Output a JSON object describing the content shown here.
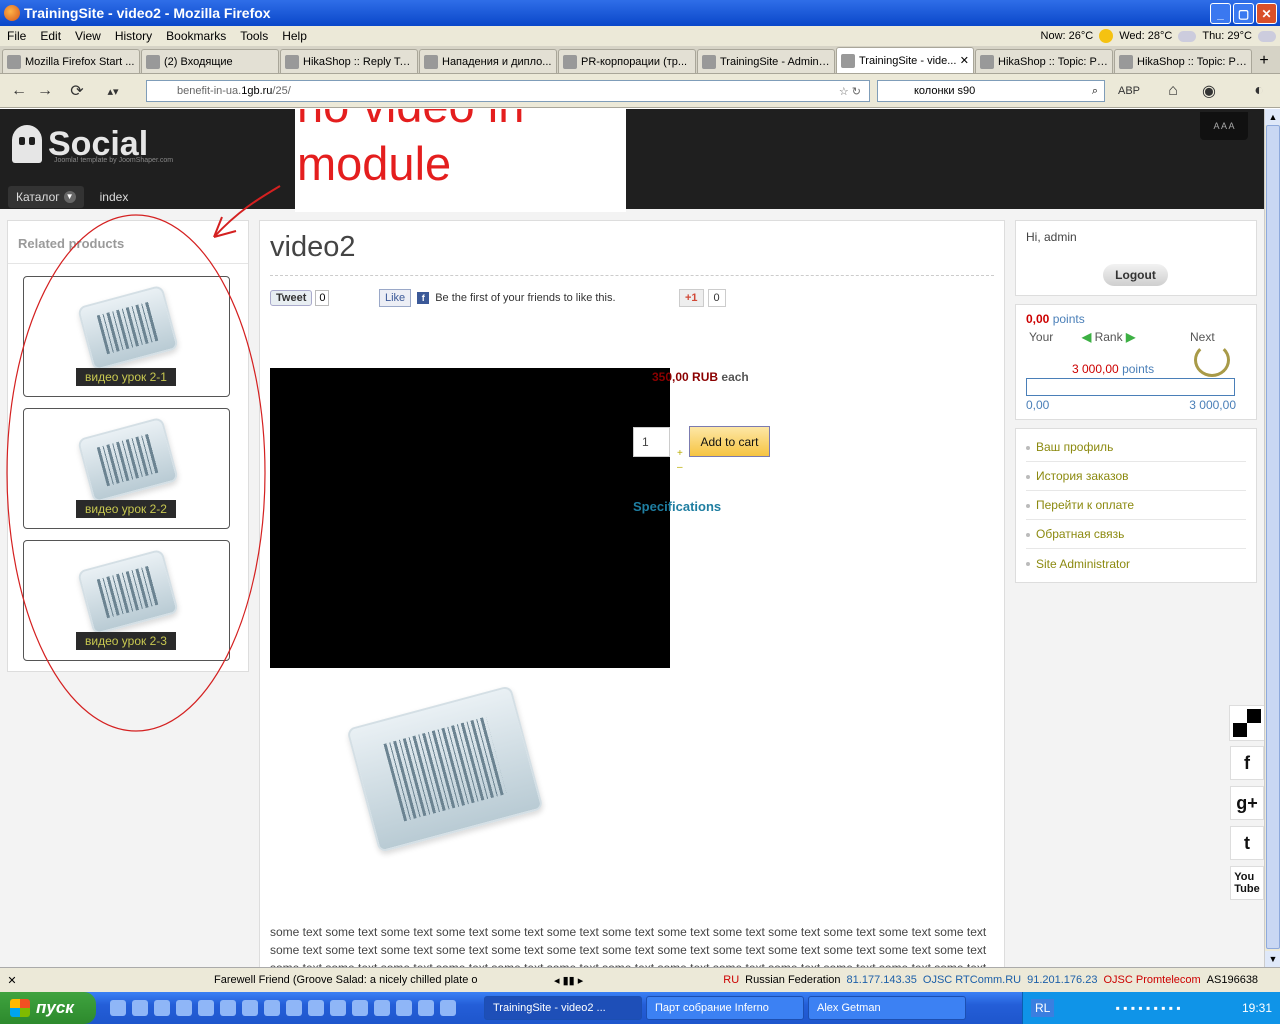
{
  "window": {
    "title": "TrainingSite - video2 - Mozilla Firefox"
  },
  "menubar": {
    "items": [
      "File",
      "Edit",
      "View",
      "History",
      "Bookmarks",
      "Tools",
      "Help"
    ]
  },
  "weather": {
    "now": "Now: 26°C",
    "wed": "Wed: 28°C",
    "thu": "Thu: 29°C"
  },
  "tabs": [
    {
      "label": "Mozilla Firefox Start ...",
      "active": false
    },
    {
      "label": "(2) Входящие",
      "active": false
    },
    {
      "label": "HikaShop :: Reply To...",
      "active": false
    },
    {
      "label": "Нападения и дипло...",
      "active": false
    },
    {
      "label": "PR-корпорации (тр...",
      "active": false
    },
    {
      "label": "TrainingSite - Adminis...",
      "active": false
    },
    {
      "label": "TrainingSite - vide...",
      "active": true
    },
    {
      "label": "HikaShop :: Topic: Pr...",
      "active": false
    },
    {
      "label": "HikaShop :: Topic: Pr...",
      "active": false
    }
  ],
  "nav": {
    "url_pre": "benefit-in-ua.",
    "url_host": "1gb.ru",
    "url_post": "/25/",
    "search": "колонки s90"
  },
  "site": {
    "logo": "Social",
    "logo_sub": "Joomla! template by JoomShaper.com",
    "fontsize": "A A A",
    "nav": [
      "Каталог",
      "index"
    ]
  },
  "annotation": {
    "text": "no video in module",
    "color": "#e41e1e"
  },
  "related": {
    "title": "Related products",
    "items": [
      "видео урок 2-1",
      "видео урок 2-2",
      "видео урок 2-3"
    ]
  },
  "product": {
    "title": "video2",
    "tweet": "Tweet",
    "tweet_count": "0",
    "like": "Like",
    "like_text": "Be the first of your friends to like this.",
    "gplus": "+1",
    "gplus_count": "0",
    "price": "350,00 RUB",
    "price_unit": "each",
    "qty": "1",
    "plus": "+",
    "minus": "–",
    "add_to_cart": "Add to cart",
    "specs": "Specifications",
    "body": "some text some text some text some text some text some text some text some text some text some text some text some text some text some text some text some text some text some text some text some text some text some text some text some text some text some text some text some text some text some text some text some text some text some text some text some text some text some text some text some text"
  },
  "user": {
    "hi": "Hi, admin",
    "logout": "Logout"
  },
  "points": {
    "current_val": "0,00",
    "current_unit": "points",
    "your": "Your",
    "rank": "Rank",
    "next": "Next",
    "next_val": "3 000,00",
    "next_unit": "points",
    "progress": 0,
    "min": "0,00",
    "max": "3 000,00"
  },
  "usermenu": [
    "Ваш профиль",
    "История заказов",
    "Перейти к оплате",
    "Обратная связь",
    "Site Administrator"
  ],
  "social_icons": [
    "delicious-icon",
    "facebook-icon",
    "google-plus-icon",
    "twitter-icon",
    "youtube-icon"
  ],
  "statusbar": {
    "song": "Farewell Friend (Groove Salad: a nicely chilled plate o",
    "country_code": "RU",
    "country": "Russian Federation",
    "ip1": "81.177.143.35",
    "isp1": "OJSC RTComm.RU",
    "ip2": "91.201.176.23",
    "isp2": "OJSC Promtelecom",
    "as": "AS196638"
  },
  "taskbar": {
    "start": "пуск",
    "buttons": [
      "TrainingSite - video2 ...",
      "Парт собрание Inferno",
      "Alex Getman"
    ],
    "lang": "RL",
    "time": "19:31"
  }
}
